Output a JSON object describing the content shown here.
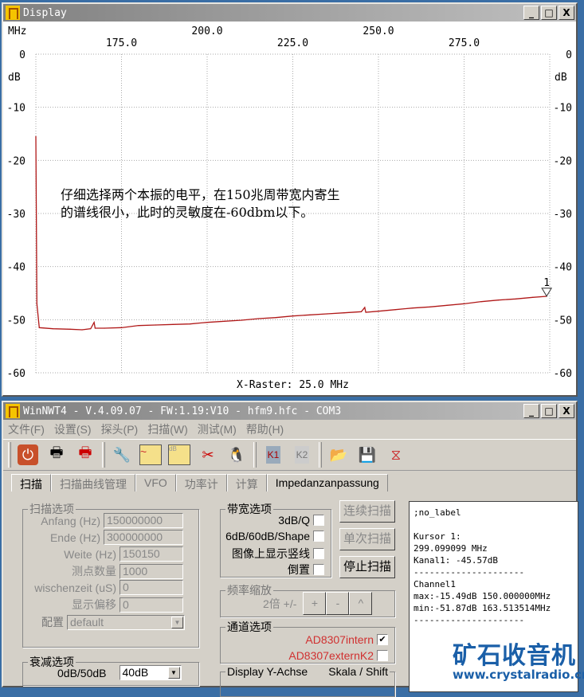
{
  "display_window": {
    "title": "Display",
    "minimize": "_",
    "maximize": "□",
    "close": "X",
    "note_line1": "仔细选择两个本振的电平，在150兆周带宽内寄生",
    "note_line2": "的谱线很小，此时的灵敏度在-60dbm以下。"
  },
  "chart_data": {
    "type": "line",
    "x_unit_label": "MHz",
    "y_unit_label": "dB",
    "xlim": [
      150,
      300
    ],
    "ylim": [
      -60,
      0
    ],
    "x_ticks_upper": [
      "200.0",
      "250.0"
    ],
    "x_ticks_lower": [
      "175.0",
      "225.0",
      "275.0"
    ],
    "y_ticks": [
      "0",
      "-10",
      "-20",
      "-30",
      "-40",
      "-50",
      "-60"
    ],
    "xlabel": "X-Raster: 25.0 MHz",
    "grid": true,
    "series": [
      {
        "name": "Channel1",
        "color": "#b01818",
        "x": [
          150,
          150.3,
          151,
          155,
          160,
          163.5,
          166,
          167,
          167.3,
          170,
          175,
          180,
          185,
          190,
          195,
          200,
          205,
          210,
          215,
          220,
          225,
          230,
          235,
          240,
          245,
          246,
          246.3,
          250,
          255,
          260,
          265,
          270,
          275,
          280,
          285,
          290,
          295,
          299.1
        ],
        "y": [
          -15.5,
          -47,
          -51.5,
          -51.7,
          -51.8,
          -51.9,
          -51.7,
          -50.5,
          -51.6,
          -51.6,
          -51.5,
          -51.1,
          -51.0,
          -50.9,
          -50.8,
          -50.5,
          -50.3,
          -50.1,
          -49.8,
          -49.6,
          -49.3,
          -49.1,
          -48.9,
          -48.7,
          -48.5,
          -47.7,
          -48.6,
          -48.4,
          -48.1,
          -47.8,
          -47.6,
          -47.3,
          -47.0,
          -46.6,
          -46.3,
          -46.1,
          -45.8,
          -45.6
        ]
      }
    ],
    "marker": {
      "label": "1",
      "x": 299.1,
      "y": -45.57
    }
  },
  "main_window": {
    "title": "WinNWT4 - V.4.09.07 - FW:1.19:V10 - hfm9.hfc - COM3",
    "minimize": "_",
    "maximize": "□",
    "close": "X",
    "menu": [
      "文件(F)",
      "设置(S)",
      "探头(P)",
      "扫描(W)",
      "测试(M)",
      "帮助(H)"
    ],
    "tabs": [
      "扫描",
      "扫描曲线管理",
      "VFO",
      "功率计",
      "计算",
      "Impedanzanpassung"
    ],
    "scan_options": {
      "title": "扫描选项",
      "fields": [
        {
          "label": "Anfang (Hz)",
          "value": "150000000"
        },
        {
          "label": "Ende (Hz)",
          "value": "300000000"
        },
        {
          "label": "Weite (Hz)",
          "value": "150150"
        },
        {
          "label": "测点数量",
          "value": "1000"
        },
        {
          "label": "wischenzeit (uS)",
          "value": "0"
        },
        {
          "label": "显示偏移",
          "value": "0"
        }
      ],
      "config_label": "配置",
      "config_value": "default"
    },
    "atten": {
      "title": "衰减选项",
      "label": "0dB/50dB",
      "value": "40dB"
    },
    "bandwidth": {
      "title": "带宽选项",
      "options": [
        {
          "label": "3dB/Q",
          "checked": false
        },
        {
          "label": "6dB/60dB/Shape",
          "checked": false
        },
        {
          "label": "图像上显示竖线",
          "checked": false
        },
        {
          "label": "倒置",
          "checked": false
        }
      ]
    },
    "buttons": {
      "continuous": "连续扫描",
      "single": "单次扫描",
      "stop": "停止扫描"
    },
    "zoom": {
      "title": "频率缩放",
      "label": "2倍 +/-",
      "plus": "+",
      "minus": "-",
      "up": "^"
    },
    "channels": {
      "title": "通道选项",
      "items": [
        {
          "label": "AD8307intern",
          "checked": true
        },
        {
          "label": "AD8307externK2",
          "checked": false
        }
      ],
      "color": "#d03030"
    },
    "display_y": {
      "title": "Display Y-Achse",
      "title2": "Skala / Shift"
    },
    "info": {
      "line1": ";no_label",
      "line2": "",
      "line3": "Kursor 1:",
      "line4": "299.099099 MHz",
      "line5": "Kanal1: -45.57dB",
      "line6": "---------------------",
      "line7": "Channel1",
      "line8": "max:-15.49dB 150.000000MHz",
      "line9": "min:-51.87dB 163.513514MHz",
      "line10": "---------------------"
    }
  },
  "watermark": {
    "text": "矿石收音机",
    "url": "www.crystalradio.cn"
  }
}
